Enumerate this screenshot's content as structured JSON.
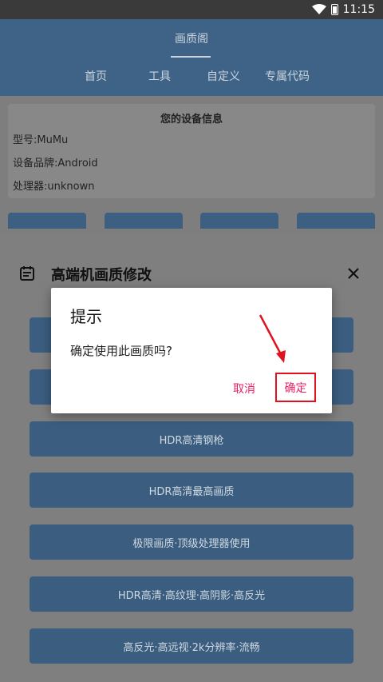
{
  "status": {
    "time": "11:15"
  },
  "app": {
    "title": "画质阁"
  },
  "tabs": [
    {
      "label": "首页",
      "active": true
    },
    {
      "label": "工具",
      "active": false
    },
    {
      "label": "自定义",
      "active": false
    },
    {
      "label": "专属代码",
      "active": false
    }
  ],
  "device_info": {
    "title": "您的设备信息",
    "model": "型号:MuMu",
    "brand": "设备品牌:Android",
    "processor": "处理器:unknown"
  },
  "sheet": {
    "title": "高端机画质修改",
    "options": [
      "HDR高清钢枪",
      "HDR高清最高画质",
      "极限画质·顶级处理器使用",
      "HDR高清·高纹理·高阴影·高反光",
      "高反光·高远视·2k分辨率·流畅"
    ]
  },
  "dialog": {
    "title": "提示",
    "message": "确定使用此画质吗?",
    "cancel_label": "取消",
    "ok_label": "确定"
  },
  "colors": {
    "app_bar": "#3e6386",
    "button": "#3b5e80",
    "dialog_accent": "#e91e63",
    "highlight_box": "#e1121f"
  }
}
